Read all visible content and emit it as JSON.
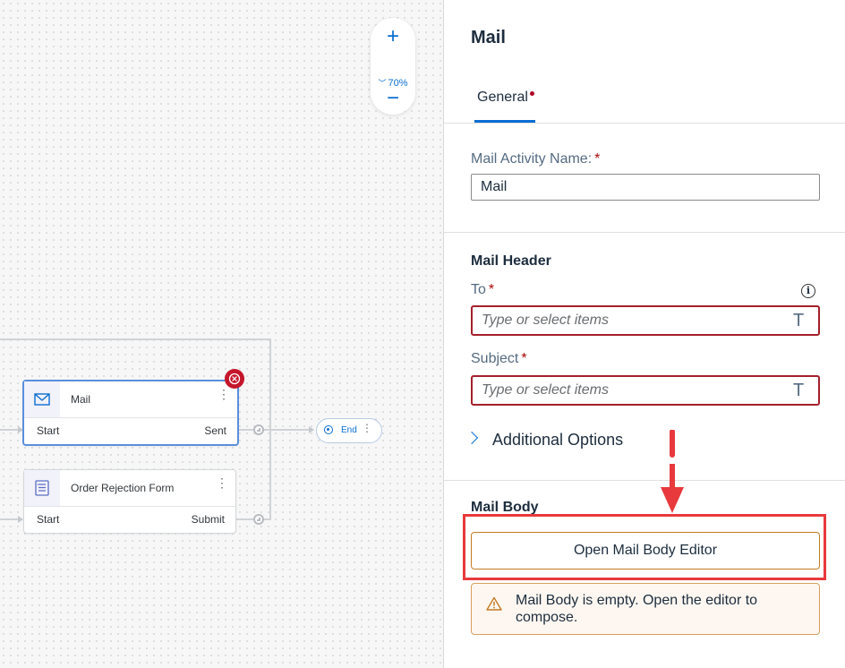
{
  "canvas": {
    "zoom": {
      "in_label": "+",
      "level": "70%",
      "out_label": "−"
    },
    "nodes": {
      "mail": {
        "title": "Mail",
        "port_in": "Start",
        "port_out": "Sent"
      },
      "form": {
        "title": "Order Rejection Form",
        "port_in": "Start",
        "port_out": "Submit"
      },
      "end": {
        "label": "End"
      }
    }
  },
  "panel": {
    "title": "Mail",
    "tabs": [
      {
        "label": "General"
      }
    ],
    "activity_name": {
      "label": "Mail Activity Name:",
      "required_mark": "*",
      "value": "Mail"
    },
    "mail_header": {
      "title": "Mail Header",
      "to": {
        "label": "To",
        "required_mark": "*",
        "placeholder": "Type or select items"
      },
      "subject": {
        "label": "Subject",
        "required_mark": "*",
        "placeholder": "Type or select items"
      },
      "token_icon": "T"
    },
    "additional_options": {
      "label": "Additional Options"
    },
    "mail_body": {
      "title": "Mail Body",
      "open_button": "Open Mail Body Editor",
      "warning": "Mail Body is empty. Open the editor to compose."
    }
  },
  "colors": {
    "accent": "#0a6ed1",
    "error": "#a51f2b",
    "annotation": "#e8393d",
    "warning_border": "#d99f5d"
  }
}
